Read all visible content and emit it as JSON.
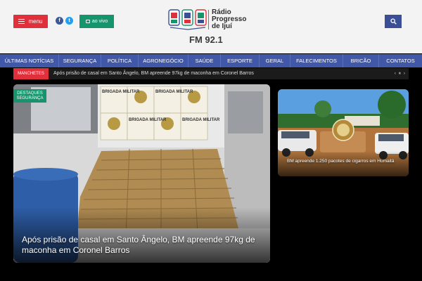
{
  "header": {
    "menu_label": "menu",
    "live_label": "ao vivo",
    "logo": {
      "line1": "Rádio",
      "line2": "Progresso",
      "line3": "de Ijuí",
      "frequency": "FM 92.1"
    }
  },
  "nav": {
    "items": [
      "ÚLTIMAS NOTÍCIAS",
      "SEGURANÇA",
      "POLÍTICA",
      "AGRONEGÓCIO",
      "SAÚDE",
      "ESPORTE",
      "GERAL",
      "FALECIMENTOS",
      "BRICÃO",
      "CONTATOS"
    ]
  },
  "ticker": {
    "label": "MANCHETES",
    "text": "Após prisão de casal em Santo Ângelo, BM apreende 97kg de maconha em Coronel Barros",
    "controls": "‹ ⏸ ›"
  },
  "main_story": {
    "category": "DESTAQUES SEGURANÇA",
    "title": "Após prisão de casal em Santo Ângelo, BM apreende 97kg de maconha em Coronel Barros",
    "image_text": {
      "banner": "BRIGADA MILITAR"
    }
  },
  "side_story": {
    "title": "BM apreende 1.250 pacotes de cigarros em Humaitá"
  },
  "colors": {
    "red": "#e0303b",
    "green": "#16946c",
    "nav_blue": "#4158a8",
    "search_blue": "#3a4f96",
    "facebook": "#3b5998",
    "twitter": "#1da1f2"
  },
  "icons": {
    "menu": "hamburger-icon",
    "live": "tv-icon",
    "search": "search-icon",
    "facebook": "facebook-icon",
    "twitter": "twitter-icon"
  }
}
